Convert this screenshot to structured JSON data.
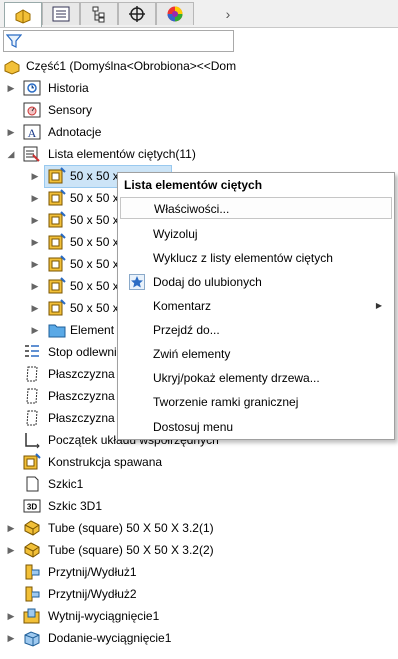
{
  "tabs": {
    "items": [
      {
        "name": "feature-manager-icon"
      },
      {
        "name": "property-manager-icon"
      },
      {
        "name": "configuration-manager-icon"
      },
      {
        "name": "dimxpert-icon"
      },
      {
        "name": "display-manager-icon"
      }
    ],
    "more": "›"
  },
  "filter": {
    "icon": "filter-icon"
  },
  "tree": {
    "root": "Część1  (Domyślna<Obrobiona><<Dom",
    "items": [
      "Historia",
      "Sensory",
      "Adnotacje",
      "Lista elementów ciętych(11)",
      "50 x 50 x",
      "50 x 50 x",
      "50 x 50 x",
      "50 x 50 x",
      "50 x 50 x",
      "50 x 50 x",
      "50 x 50 x",
      "Element",
      "Stop odlewni",
      "Płaszczyzna p",
      "Płaszczyzna g",
      "Płaszczyzna p",
      "Początek układu współrzędnych",
      "Konstrukcja spawana",
      "Szkic1",
      "Szkic 3D1",
      "Tube (square) 50 X 50 X 3.2(1)",
      "Tube (square) 50 X 50 X 3.2(2)",
      "Przytnij/Wydłuż1",
      "Przytnij/Wydłuż2",
      "Wytnij-wyciągnięcie1",
      "Dodanie-wyciągnięcie1"
    ]
  },
  "context_menu": {
    "title": "Lista elementów ciętych",
    "items": [
      "Właściwości...",
      "Wyizoluj",
      "Wyklucz z listy elementów ciętych",
      "Dodaj do ulubionych",
      "Komentarz",
      "Przejdź do...",
      "Zwiń elementy",
      "Ukryj/pokaż elementy drzewa...",
      "Tworzenie ramki granicznej",
      "Dostosuj menu"
    ],
    "submenu_arrow": "▶"
  },
  "colors": {
    "selection": "#cce4f7",
    "accent": "#2b6cc4"
  }
}
